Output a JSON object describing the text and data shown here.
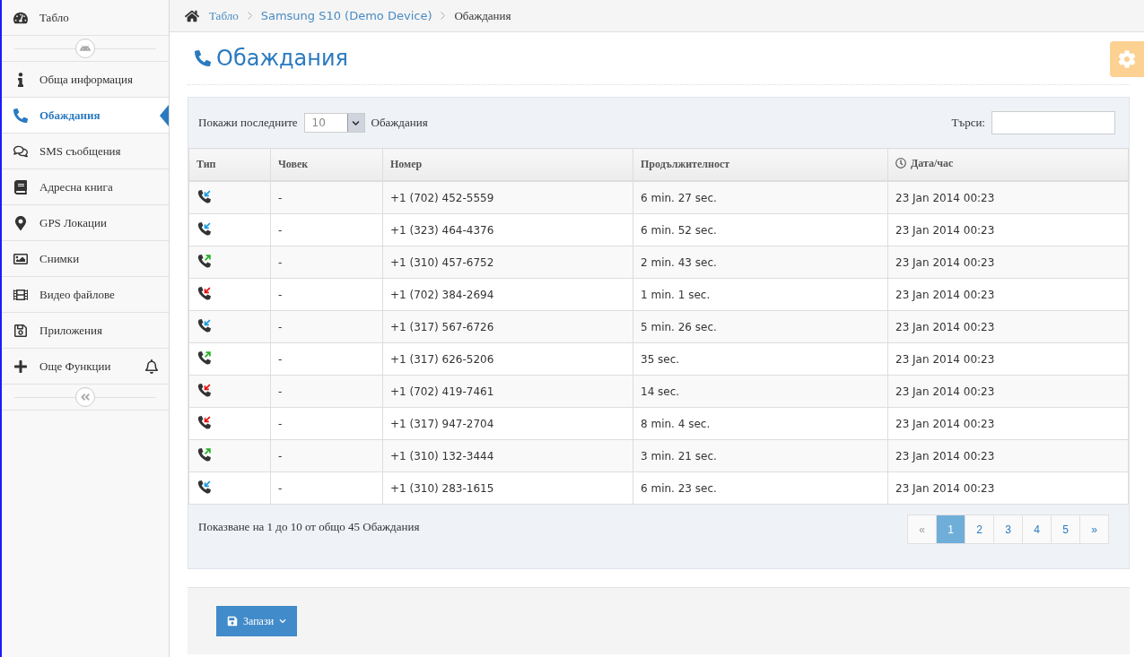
{
  "sidebar": {
    "top_item": {
      "label": "Табло"
    },
    "items": [
      {
        "label": "Обща информация",
        "selected": false
      },
      {
        "label": "Обаждания",
        "selected": true
      },
      {
        "label": "SMS съобщения",
        "selected": false
      },
      {
        "label": "Адресна книга",
        "selected": false
      },
      {
        "label": "GPS Локации",
        "selected": false
      },
      {
        "label": "Снимки",
        "selected": false
      },
      {
        "label": "Видео файлове",
        "selected": false
      },
      {
        "label": "Приложения",
        "selected": false
      },
      {
        "label": "Още Функции",
        "selected": false
      }
    ]
  },
  "breadcrumb": [
    "Табло",
    "Samsung S10 (Demo Device)",
    "Обаждания"
  ],
  "page_title": "Обаждания",
  "table_controls": {
    "show_label": "Покажи последните",
    "page_size": "10",
    "show_suffix": "Обаждания",
    "search_label": "Търси:"
  },
  "table": {
    "columns": [
      "Тип",
      "Човек",
      "Номер",
      "Продължителност",
      "Дата/час"
    ],
    "rows": [
      {
        "kind": "incoming",
        "person": "-",
        "number": "+1 (702) 452-5559",
        "duration": "6 min. 27 sec.",
        "datetime": "23 Jan 2014 00:23"
      },
      {
        "kind": "incoming",
        "person": "-",
        "number": "+1 (323) 464-4376",
        "duration": "6 min. 52 sec.",
        "datetime": "23 Jan 2014 00:23"
      },
      {
        "kind": "outgoing",
        "person": "-",
        "number": "+1 (310) 457-6752",
        "duration": "2 min. 43 sec.",
        "datetime": "23 Jan 2014 00:23"
      },
      {
        "kind": "missed",
        "person": "-",
        "number": "+1 (702) 384-2694",
        "duration": "1 min. 1 sec.",
        "datetime": "23 Jan 2014 00:23"
      },
      {
        "kind": "incoming",
        "person": "-",
        "number": "+1 (317) 567-6726",
        "duration": "5 min. 26 sec.",
        "datetime": "23 Jan 2014 00:23"
      },
      {
        "kind": "outgoing",
        "person": "-",
        "number": "+1 (317) 626-5206",
        "duration": "35 sec.",
        "datetime": "23 Jan 2014 00:23"
      },
      {
        "kind": "missed",
        "person": "-",
        "number": "+1 (702) 419-7461",
        "duration": "14 sec.",
        "datetime": "23 Jan 2014 00:23"
      },
      {
        "kind": "missed",
        "person": "-",
        "number": "+1 (317) 947-2704",
        "duration": "8 min. 4 sec.",
        "datetime": "23 Jan 2014 00:23"
      },
      {
        "kind": "outgoing",
        "person": "-",
        "number": "+1 (310) 132-3444",
        "duration": "3 min. 21 sec.",
        "datetime": "23 Jan 2014 00:23"
      },
      {
        "kind": "incoming",
        "person": "-",
        "number": "+1 (310) 283-1615",
        "duration": "6 min. 23 sec.",
        "datetime": "23 Jan 2014 00:23"
      }
    ]
  },
  "footer_info": "Показване на 1 до 10 от общо 45 Обаждания",
  "pagination": {
    "prev": "«",
    "next": "»",
    "pages": [
      {
        "label": "1",
        "selected": true
      },
      {
        "label": "2",
        "selected": false
      },
      {
        "label": "3",
        "selected": false
      },
      {
        "label": "4",
        "selected": false
      },
      {
        "label": "5",
        "selected": false
      }
    ]
  },
  "save_button": "Запази"
}
